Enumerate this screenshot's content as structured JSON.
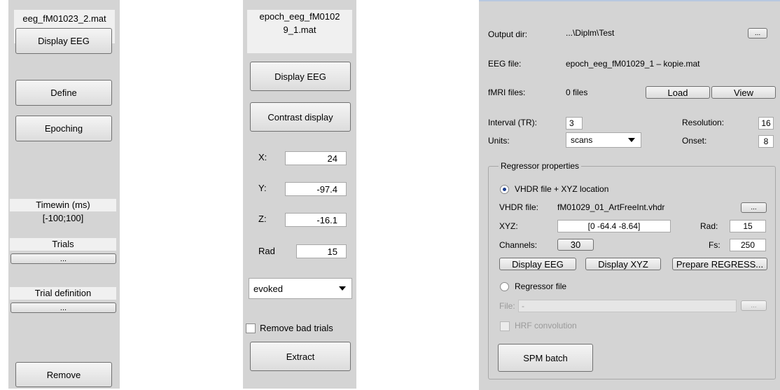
{
  "panel1": {
    "file": "eeg_fM01023_2.mat",
    "display_eeg": "Display EEG",
    "define": "Define",
    "epoching": "Epoching",
    "timewin_label": "Timewin (ms)",
    "timewin_value": "[-100;100]",
    "trials_label": "Trials",
    "trials_button": "...",
    "trial_def_label": "Trial definition",
    "trial_def_button": "...",
    "remove": "Remove"
  },
  "panel2": {
    "file_line1": "epoch_eeg_fM0102",
    "file_line2": "9_1.mat",
    "display_eeg": "Display EEG",
    "contrast_display": "Contrast display",
    "x_label": "X:",
    "x_value": "24",
    "y_label": "Y:",
    "y_value": "-97.4",
    "z_label": "Z:",
    "z_value": "-16.1",
    "rad_label": "Rad",
    "rad_value": "15",
    "mode_selected": "evoked",
    "remove_bad_trials": "Remove bad trials",
    "remove_bad_trials_checked": false,
    "extract": "Extract"
  },
  "panel3": {
    "output_dir_label": "Output dir:",
    "output_dir_value": "...\\Diplm\\Test",
    "browse_button": "...",
    "eeg_file_label": "EEG file:",
    "eeg_file_value": "epoch_eeg_fM01029_1 – kopie.mat",
    "fmri_label": "fMRI files:",
    "fmri_value": "0 files",
    "load": "Load",
    "view": "View",
    "interval_label": "Interval (TR):",
    "interval_value": "3",
    "resolution_label": "Resolution:",
    "resolution_value": "16",
    "units_label": "Units:",
    "units_selected": "scans",
    "onset_label": "Onset:",
    "onset_value": "8",
    "regressor": {
      "group_title": "Regressor properties",
      "option_vhdr": "VHDR file + XYZ location",
      "vhdr_label": "VHDR file:",
      "vhdr_value": "fM01029_01_ArtFreeInt.vhdr",
      "vhdr_browse": "...",
      "xyz_label": "XYZ:",
      "xyz_value": "[0 -64.4 -8.64]",
      "rad_label": "Rad:",
      "rad_value": "15",
      "channels_label": "Channels:",
      "channels_value": "30",
      "fs_label": "Fs:",
      "fs_value": "250",
      "display_eeg": "Display EEG",
      "display_xyz": "Display XYZ",
      "prepare": "Prepare REGRESS...",
      "option_file": "Regressor file",
      "file_label": "File:",
      "file_value": "-",
      "file_browse": "...",
      "hrf": "HRF convolution"
    },
    "spm_batch": "SPM batch"
  }
}
